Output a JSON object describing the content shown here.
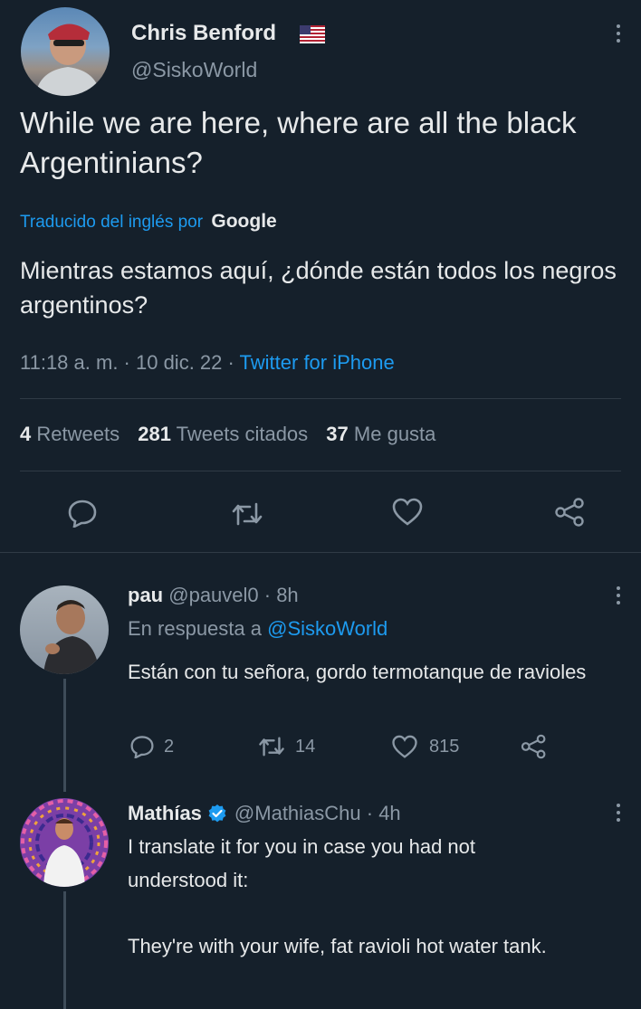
{
  "main_tweet": {
    "author_name": "Chris Benford",
    "author_handle": "@SiskoWorld",
    "text": "While we are here, where are all the black Argentinians?",
    "translated_prefix": "Traducido del inglés por",
    "translator": "Google",
    "translated_text": "Mientras estamos aquí, ¿dónde están todos los negros argentinos?",
    "timestamp": "11:18 a. m. · 10 dic. 22 · ",
    "source": "Twitter for iPhone",
    "stats": {
      "retweets_count": "4",
      "retweets_label": "Retweets",
      "quotes_count": "281",
      "quotes_label": "Tweets citados",
      "likes_count": "37",
      "likes_label": "Me gusta"
    }
  },
  "replies": [
    {
      "name": "pau",
      "handle": "@pauvel0 · 8h",
      "reply_prefix": "En respuesta a",
      "reply_to": "@SiskoWorld",
      "text": "Están con tu señora, gordo termotanque de ravioles",
      "reply_count": "2",
      "retweet_count": "14",
      "like_count": "815"
    },
    {
      "name": "Mathías",
      "handle": "@MathiasChu · 4h",
      "text_line1": "I translate it for you in case you had not understood it:",
      "text_line2": "They're with your wife, fat ravioli hot water tank."
    }
  ],
  "colors": {
    "background": "#15202b",
    "accent": "#1d9bf0",
    "muted": "#8b98a5"
  }
}
